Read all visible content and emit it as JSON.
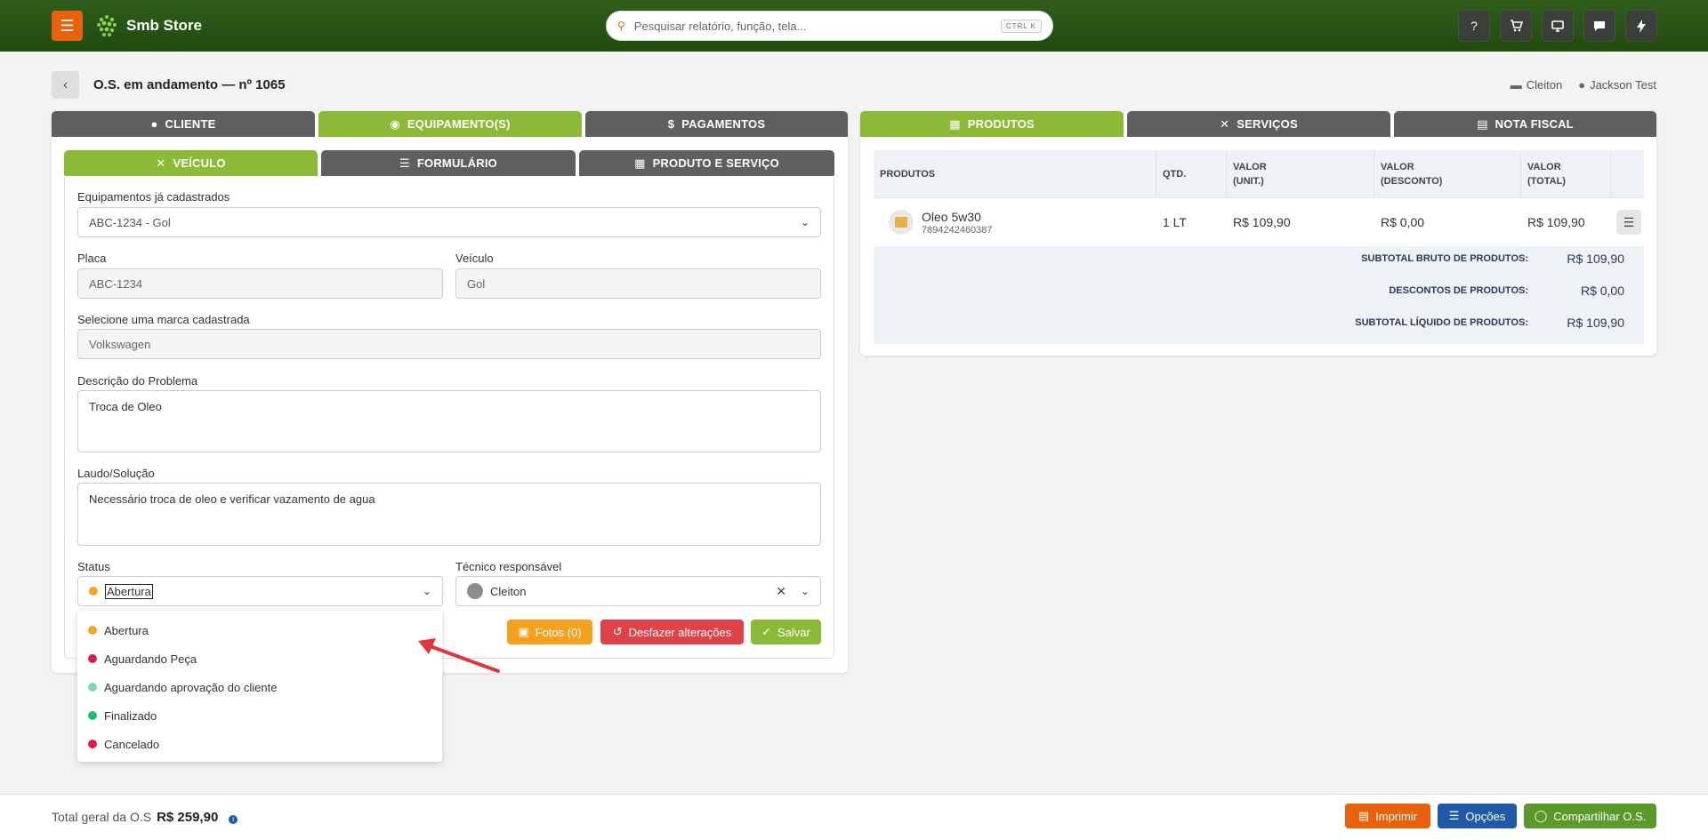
{
  "topbar": {
    "brand": "Smb Store",
    "search_placeholder": "Pesquisar relatório, função, tela...",
    "search_shortcut": "CTRL K",
    "icons": [
      "help-icon",
      "cart-icon",
      "monitor-icon",
      "chat-icon",
      "bolt-icon"
    ]
  },
  "header": {
    "title": "O.S. em andamento — nº 1065",
    "store": "Cleiton",
    "user": "Jackson Test"
  },
  "left_tabs": [
    "CLIENTE",
    "EQUIPAMENTO(S)",
    "PAGAMENTOS"
  ],
  "sub_tabs": [
    "VEÍCULO",
    "FORMULÁRIO",
    "PRODUTO E SERVIÇO"
  ],
  "form": {
    "equip_label": "Equipamentos já cadastrados",
    "equip_value": "ABC-1234 - Gol",
    "placa_label": "Placa",
    "placa_value": "ABC-1234",
    "veiculo_label": "Veículo",
    "veiculo_value": "Gol",
    "marca_label": "Selecione uma marca cadastrada",
    "marca_value": "Volkswagen",
    "descricao_label": "Descrição do Problema",
    "descricao_value": "Troca de Oleo",
    "laudo_label": "Laudo/Solução",
    "laudo_value": "Necessário troca de oleo e verificar vazamento de agua",
    "status_label": "Status",
    "status_value": "Abertura",
    "tecnico_label": "Técnico responsável",
    "tecnico_value": "Cleiton"
  },
  "status_options": [
    {
      "label": "Abertura",
      "color": "#f5a623"
    },
    {
      "label": "Aguardando Peça",
      "color": "#d81b60"
    },
    {
      "label": "Aguardando aprovação do cliente",
      "color": "#7fd6b8"
    },
    {
      "label": "Finalizado",
      "color": "#1dbf73"
    },
    {
      "label": "Cancelado",
      "color": "#e0174a"
    }
  ],
  "actions": {
    "fotos": "Fotos (0)",
    "desfazer": "Desfazer alterações",
    "salvar": "Salvar"
  },
  "right_tabs": [
    "PRODUTOS",
    "SERVIÇOS",
    "NOTA FISCAL"
  ],
  "products": {
    "headers": [
      "PRODUTOS",
      "QTD.",
      "VALOR\n(UNIT.)",
      "VALOR\n(DESCONTO)",
      "VALOR\n(TOTAL)"
    ],
    "rows": [
      {
        "name": "Oleo 5w30",
        "code": "7894242460387",
        "qtd": "1 LT",
        "unit": "R$ 109,90",
        "desconto": "R$ 0,00",
        "total": "R$ 109,90"
      }
    ],
    "subtotal_bruto_label": "SUBTOTAL BRUTO DE PRODUTOS:",
    "subtotal_bruto": "R$ 109,90",
    "descontos_label": "DESCONTOS DE PRODUTOS:",
    "descontos": "R$ 0,00",
    "subtotal_liquido_label": "SUBTOTAL LÍQUIDO DE PRODUTOS:",
    "subtotal_liquido": "R$ 109,90"
  },
  "footer": {
    "total_label": "Total geral da O.S",
    "total_value": "R$ 259,90",
    "imprimir": "Imprimir",
    "opcoes": "Opções",
    "compartilhar": "Compartilhar O.S."
  },
  "colors": {
    "accent_green": "#8aba36",
    "tab_gray": "#5f5f5f",
    "orange": "#e8610c",
    "red": "#e0424a",
    "blue": "#1e5aa8"
  }
}
